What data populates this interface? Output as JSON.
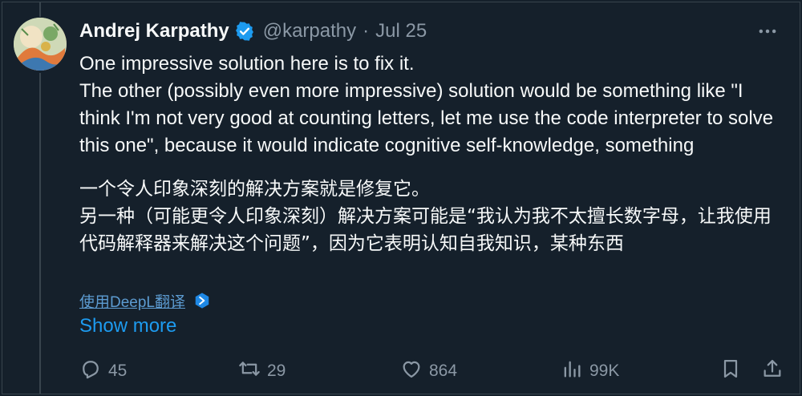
{
  "author": {
    "name": "Andrej Karpathy",
    "handle": "@karpathy",
    "separator": "·",
    "date": "Jul 25"
  },
  "tweet": {
    "text_en": "One impressive solution here is to fix it.\nThe other (possibly even more impressive) solution would be something like \"I think I'm not very good at counting letters, let me use the code interpreter to solve this one\", because it would indicate cognitive self-knowledge, something",
    "text_zh": "一个令人印象深刻的解决方案就是修复它。\n另一种（可能更令人印象深刻）解决方案可能是“我认为我不太擅长数字母，让我使用代码解释器来解决这个问题”，因为它表明认知自我知识，某种东西",
    "translate_label": "使用DeepL翻译",
    "show_more": "Show more"
  },
  "actions": {
    "replies": "45",
    "retweets": "29",
    "likes": "864",
    "views": "99K"
  },
  "colors": {
    "background": "#15202b",
    "text": "#f7f9f9",
    "muted": "#8b98a5",
    "link": "#1d9bf0",
    "verified": "#1d9bf0"
  },
  "icons": {
    "verified": "verified-badge-icon",
    "more": "more-horizontal-icon",
    "deepl": "deepl-icon",
    "reply": "reply-icon",
    "retweet": "retweet-icon",
    "like": "heart-icon",
    "views": "views-bar-chart-icon",
    "bookmark": "bookmark-icon",
    "share": "share-icon"
  }
}
